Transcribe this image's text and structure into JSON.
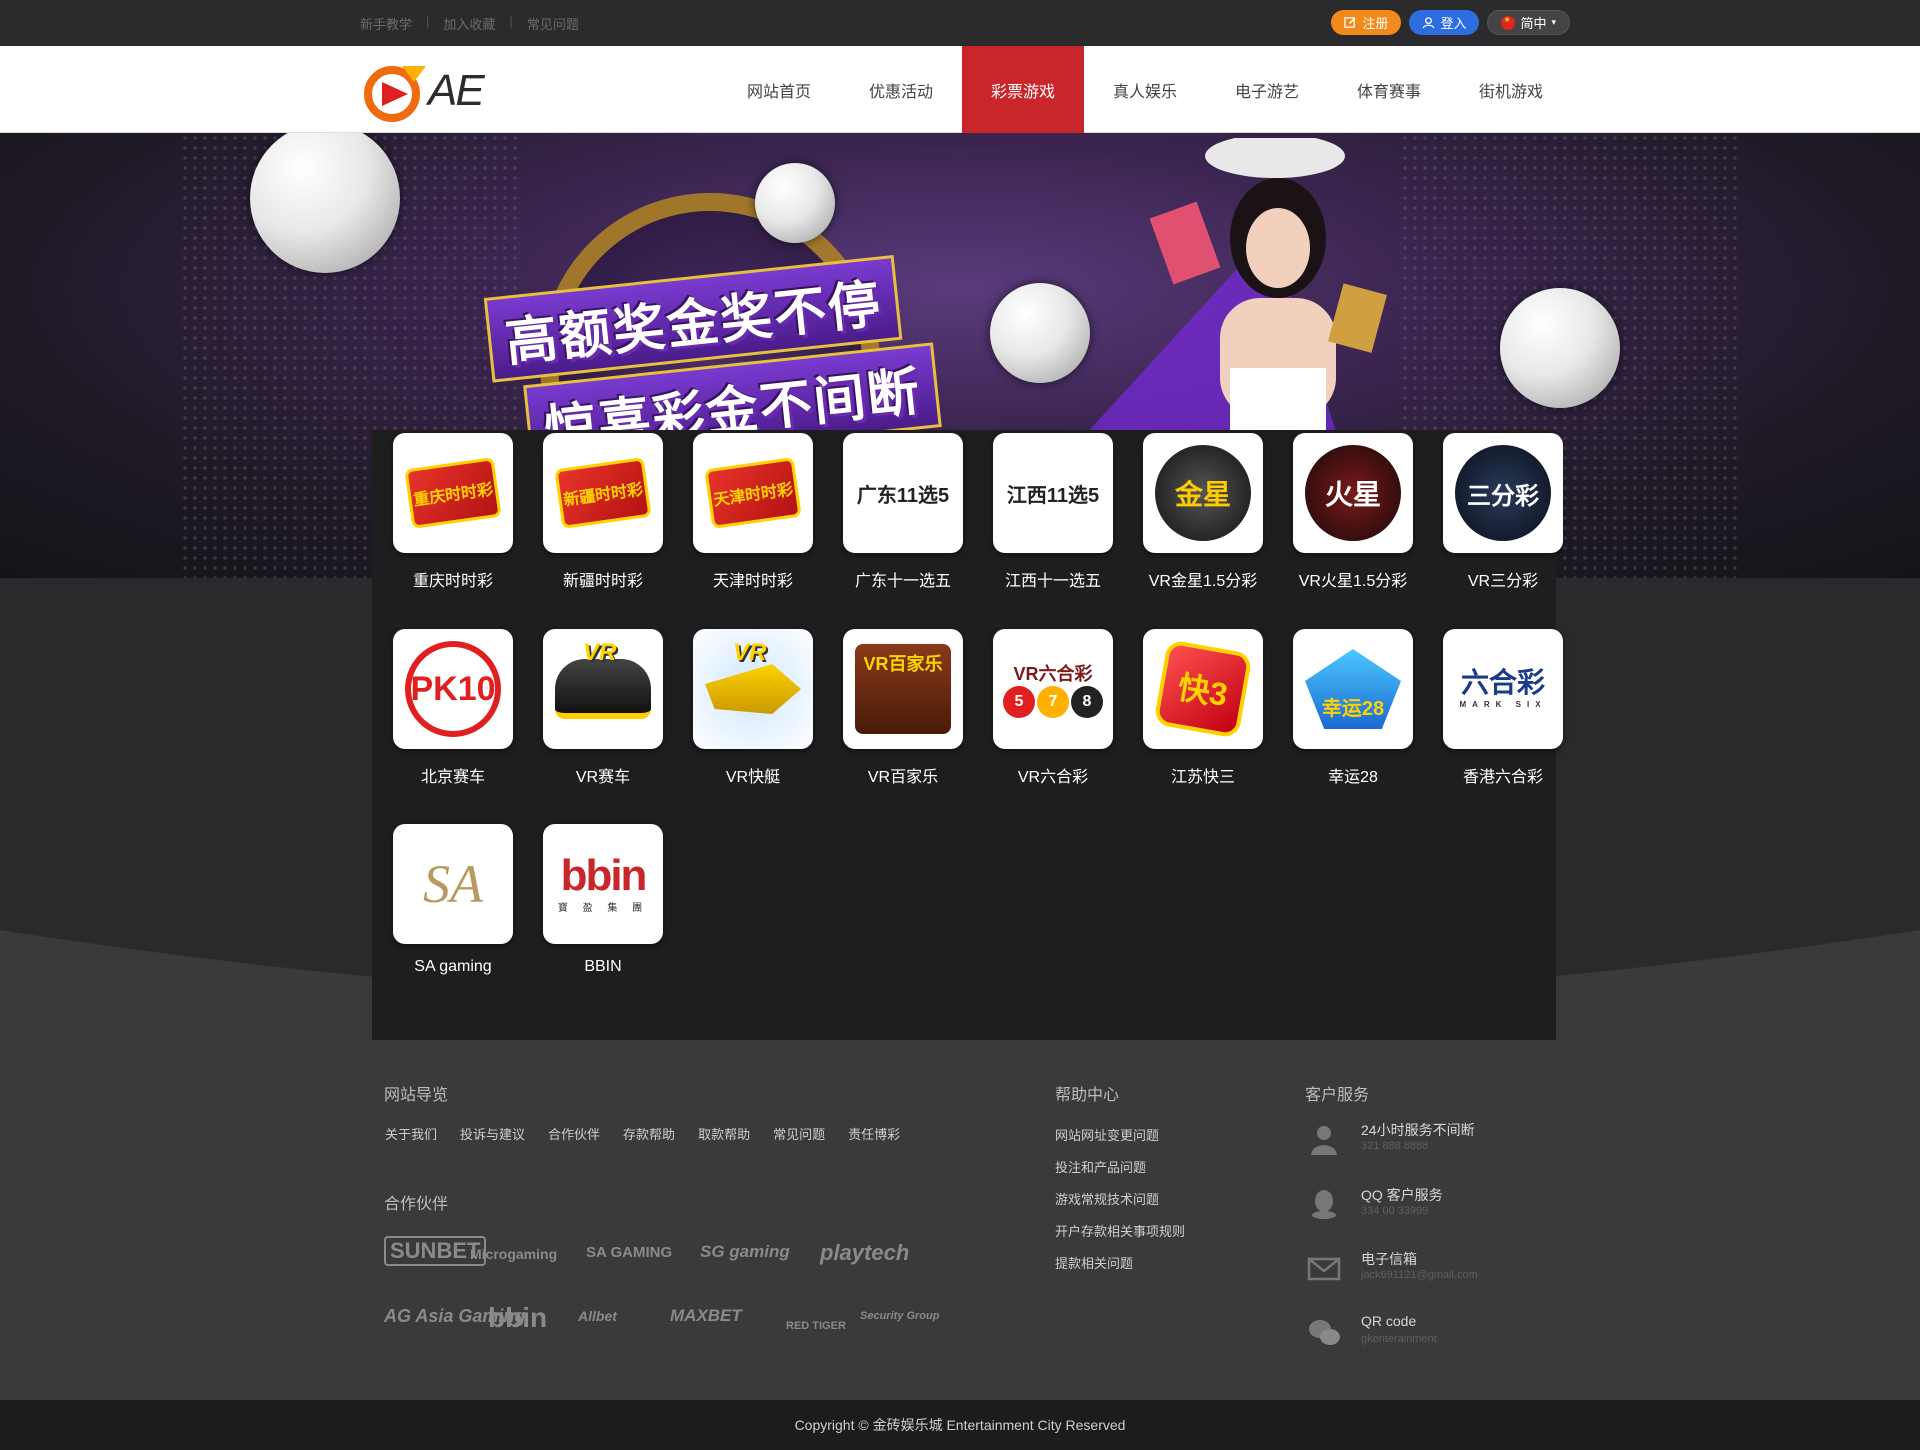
{
  "topbar": {
    "links": [
      "新手教学",
      "加入收藏",
      "常见问题"
    ],
    "register_label": "注册",
    "login_label": "登入",
    "language_label": "简中"
  },
  "brand": {
    "logo_text": "AE"
  },
  "nav": {
    "items": [
      {
        "label": "网站首页"
      },
      {
        "label": "优惠活动"
      },
      {
        "label": "彩票游戏",
        "active": true
      },
      {
        "label": "真人娱乐"
      },
      {
        "label": "电子游艺"
      },
      {
        "label": "体育赛事"
      },
      {
        "label": "街机游戏"
      }
    ]
  },
  "banner": {
    "slogan_line1": "高额奖金奖不停",
    "slogan_line2": "惊喜彩金不间断"
  },
  "games": [
    {
      "label": "重庆时时彩",
      "icon": "chongqing-ssc-icon",
      "art": "重庆时时彩"
    },
    {
      "label": "新疆时时彩",
      "icon": "xinjiang-ssc-icon",
      "art": "新疆时时彩"
    },
    {
      "label": "天津时时彩",
      "icon": "tianjin-ssc-icon",
      "art": "天津时时彩"
    },
    {
      "label": "广东十一选五",
      "icon": "guangdong-11x5-icon",
      "art": "广东11选5"
    },
    {
      "label": "江西十一选五",
      "icon": "jiangxi-11x5-icon",
      "art": "江西11选5"
    },
    {
      "label": "VR金星1.5分彩",
      "icon": "vr-venus-icon",
      "art": "金星"
    },
    {
      "label": "VR火星1.5分彩",
      "icon": "vr-mars-icon",
      "art": "火星"
    },
    {
      "label": "VR三分彩",
      "icon": "vr-3min-icon",
      "art": "三分彩"
    },
    {
      "label": "北京赛车",
      "icon": "beijing-pk10-icon",
      "art": "PK10"
    },
    {
      "label": "VR赛车",
      "icon": "vr-racing-icon",
      "art": "VR"
    },
    {
      "label": "VR快艇",
      "icon": "vr-boat-icon",
      "art": "VR"
    },
    {
      "label": "VR百家乐",
      "icon": "vr-baccarat-icon",
      "art": "VR百家乐"
    },
    {
      "label": "VR六合彩",
      "icon": "vr-mark-six-icon",
      "art": "VR六合彩"
    },
    {
      "label": "江苏快三",
      "icon": "jiangsu-k3-icon",
      "art": "快3"
    },
    {
      "label": "幸运28",
      "icon": "lucky-28-icon",
      "art": "幸运28"
    },
    {
      "label": "香港六合彩",
      "icon": "hk-mark-six-icon",
      "art": "六合彩"
    },
    {
      "label": "SA gaming",
      "icon": "sa-gaming-icon",
      "art": "SA"
    },
    {
      "label": "BBIN",
      "icon": "bbin-icon",
      "art": "bbin"
    }
  ],
  "footer": {
    "nav_title": "网站导览",
    "nav_links": [
      "关于我们",
      "投诉与建议",
      "合作伙伴",
      "存款帮助",
      "取款帮助",
      "常见问题",
      "责任博彩"
    ],
    "partners_title": "合作伙伴",
    "partners": [
      "SUNBET",
      "Microgaming",
      "SA GAMING",
      "SG gaming",
      "playtech",
      "AG Asia Gaming",
      "bbin",
      "Allbet",
      "MAXBET",
      "RED TIGER",
      "Security Group"
    ],
    "help_title": "帮助中心",
    "help_links": [
      "网站网址变更问题",
      "投注和产品问题",
      "游戏常规技术问题",
      "开户存款相关事项规则",
      "提款相关问题"
    ],
    "service_title": "客户服务",
    "services": [
      {
        "title": "24小时服务不间断",
        "sub": "321 888 8888",
        "icon": "customer-service-icon"
      },
      {
        "title": "QQ 客户服务",
        "sub": "334 00 33999",
        "icon": "qq-icon"
      },
      {
        "title": "电子信箱",
        "sub": "jack691121@gmail.com",
        "icon": "mail-icon"
      },
      {
        "title": "QR code",
        "sub": "gkenterainment",
        "icon": "wechat-icon"
      }
    ],
    "copyright": "Copyright © 金砖娱乐城 Entertainment City Reserved"
  },
  "colors": {
    "accent": "#c8262a",
    "register": "#f08a1c",
    "login": "#2e6de0"
  }
}
